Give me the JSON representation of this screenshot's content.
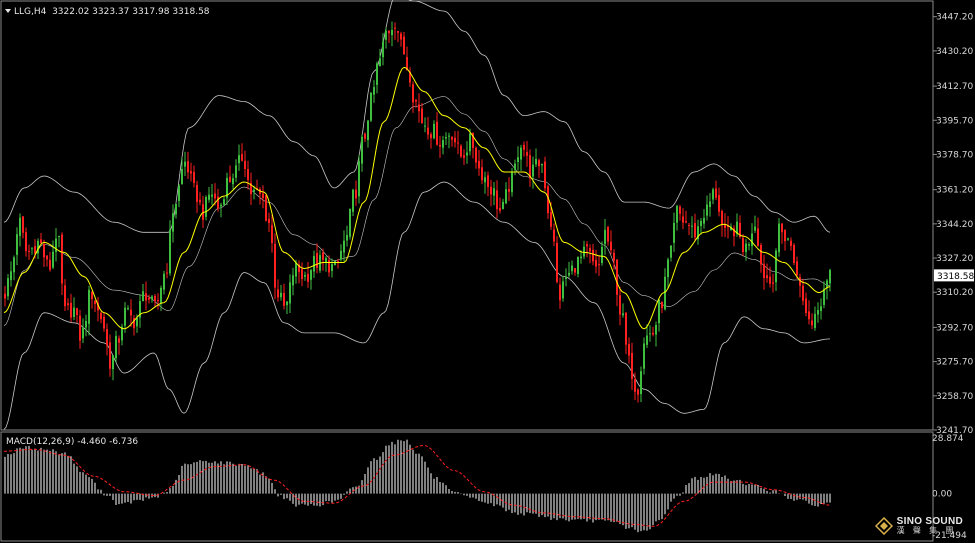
{
  "header": {
    "symbol_line": "LLG,H4  3322.02 3323.37 3317.98 3318.58",
    "macd_label": "MACD(12,26,9) -4.460 -6.736"
  },
  "logo": {
    "name": "SINO SOUND",
    "subtitle": "漢 聲 集 團"
  },
  "colors": {
    "background": "#000000",
    "bull": "#3fbf3f",
    "bear": "#ff2020",
    "ma": "#ffff00",
    "bands": "#c8c8c8",
    "macd_hist": "#ffffff",
    "macd_signal": "#ff2020",
    "price_tag_bg": "#ffffff",
    "price_tag_text": "#000000"
  },
  "chart_data": [
    {
      "type": "candlestick",
      "title": "LLG,H4",
      "last_price": "3318.58",
      "ylim": [
        3241.7,
        3455
      ],
      "y_ticks": [
        "3447.20",
        "3430.20",
        "3412.70",
        "3395.70",
        "3378.70",
        "3361.20",
        "3344.20",
        "3327.20",
        "3310.20",
        "3292.70",
        "3275.70",
        "3258.70",
        "3241.70"
      ],
      "anchors": [
        [
          0,
          3310
        ],
        [
          6,
          3320
        ],
        [
          14,
          3345
        ],
        [
          22,
          3330
        ],
        [
          34,
          3335
        ],
        [
          44,
          3322
        ],
        [
          52,
          3340
        ],
        [
          60,
          3300
        ],
        [
          68,
          3302
        ],
        [
          76,
          3288
        ],
        [
          86,
          3310
        ],
        [
          96,
          3298
        ],
        [
          106,
          3275
        ],
        [
          112,
          3285
        ],
        [
          120,
          3300
        ],
        [
          130,
          3296
        ],
        [
          140,
          3310
        ],
        [
          150,
          3302
        ],
        [
          160,
          3320
        ],
        [
          170,
          3355
        ],
        [
          180,
          3375
        ],
        [
          190,
          3360
        ],
        [
          198,
          3350
        ],
        [
          206,
          3360
        ],
        [
          214,
          3352
        ],
        [
          222,
          3365
        ],
        [
          230,
          3370
        ],
        [
          238,
          3378
        ],
        [
          246,
          3360
        ],
        [
          256,
          3358
        ],
        [
          264,
          3345
        ],
        [
          272,
          3310
        ],
        [
          280,
          3302
        ],
        [
          290,
          3322
        ],
        [
          300,
          3318
        ],
        [
          310,
          3325
        ],
        [
          320,
          3325
        ],
        [
          330,
          3322
        ],
        [
          340,
          3335
        ],
        [
          350,
          3360
        ],
        [
          358,
          3385
        ],
        [
          366,
          3405
        ],
        [
          374,
          3425
        ],
        [
          382,
          3440
        ],
        [
          390,
          3445
        ],
        [
          398,
          3430
        ],
        [
          404,
          3420
        ],
        [
          410,
          3405
        ],
        [
          418,
          3395
        ],
        [
          428,
          3390
        ],
        [
          436,
          3385
        ],
        [
          446,
          3390
        ],
        [
          456,
          3378
        ],
        [
          466,
          3385
        ],
        [
          476,
          3370
        ],
        [
          486,
          3362
        ],
        [
          496,
          3350
        ],
        [
          506,
          3365
        ],
        [
          516,
          3385
        ],
        [
          526,
          3370
        ],
        [
          536,
          3375
        ],
        [
          546,
          3345
        ],
        [
          554,
          3308
        ],
        [
          562,
          3318
        ],
        [
          572,
          3325
        ],
        [
          582,
          3330
        ],
        [
          592,
          3320
        ],
        [
          600,
          3340
        ],
        [
          608,
          3325
        ],
        [
          616,
          3300
        ],
        [
          624,
          3275
        ],
        [
          632,
          3262
        ],
        [
          640,
          3288
        ],
        [
          648,
          3290
        ],
        [
          656,
          3305
        ],
        [
          664,
          3325
        ],
        [
          672,
          3350
        ],
        [
          680,
          3345
        ],
        [
          690,
          3340
        ],
        [
          700,
          3350
        ],
        [
          710,
          3360
        ],
        [
          720,
          3338
        ],
        [
          730,
          3342
        ],
        [
          740,
          3332
        ],
        [
          750,
          3345
        ],
        [
          758,
          3320
        ],
        [
          766,
          3315
        ],
        [
          774,
          3340
        ],
        [
          782,
          3338
        ],
        [
          790,
          3325
        ],
        [
          798,
          3305
        ],
        [
          806,
          3295
        ],
        [
          814,
          3305
        ],
        [
          822,
          3318
        ],
        [
          826,
          3322
        ]
      ],
      "ma_anchors": [
        [
          0,
          3300
        ],
        [
          20,
          3320
        ],
        [
          40,
          3335
        ],
        [
          60,
          3330
        ],
        [
          80,
          3318
        ],
        [
          100,
          3300
        ],
        [
          120,
          3292
        ],
        [
          140,
          3300
        ],
        [
          160,
          3305
        ],
        [
          180,
          3330
        ],
        [
          200,
          3350
        ],
        [
          220,
          3358
        ],
        [
          240,
          3365
        ],
        [
          260,
          3360
        ],
        [
          280,
          3330
        ],
        [
          300,
          3322
        ],
        [
          320,
          3325
        ],
        [
          340,
          3325
        ],
        [
          360,
          3355
        ],
        [
          380,
          3395
        ],
        [
          400,
          3422
        ],
        [
          420,
          3410
        ],
        [
          440,
          3398
        ],
        [
          460,
          3392
        ],
        [
          480,
          3382
        ],
        [
          500,
          3370
        ],
        [
          520,
          3370
        ],
        [
          540,
          3360
        ],
        [
          560,
          3335
        ],
        [
          580,
          3330
        ],
        [
          600,
          3328
        ],
        [
          620,
          3310
        ],
        [
          640,
          3292
        ],
        [
          660,
          3310
        ],
        [
          680,
          3330
        ],
        [
          700,
          3340
        ],
        [
          720,
          3344
        ],
        [
          740,
          3338
        ],
        [
          760,
          3330
        ],
        [
          780,
          3325
        ],
        [
          800,
          3315
        ],
        [
          815,
          3310
        ],
        [
          826,
          3313
        ]
      ],
      "upper_band_anchors": [
        [
          0,
          3345
        ],
        [
          20,
          3362
        ],
        [
          40,
          3368
        ],
        [
          70,
          3360
        ],
        [
          110,
          3345
        ],
        [
          140,
          3340
        ],
        [
          165,
          3340
        ],
        [
          185,
          3392
        ],
        [
          215,
          3408
        ],
        [
          240,
          3405
        ],
        [
          265,
          3398
        ],
        [
          290,
          3385
        ],
        [
          310,
          3378
        ],
        [
          330,
          3362
        ],
        [
          350,
          3370
        ],
        [
          370,
          3420
        ],
        [
          392,
          3458
        ],
        [
          410,
          3455
        ],
        [
          440,
          3450
        ],
        [
          460,
          3440
        ],
        [
          480,
          3428
        ],
        [
          500,
          3408
        ],
        [
          520,
          3398
        ],
        [
          540,
          3400
        ],
        [
          560,
          3395
        ],
        [
          580,
          3380
        ],
        [
          600,
          3370
        ],
        [
          620,
          3355
        ],
        [
          640,
          3355
        ],
        [
          665,
          3352
        ],
        [
          690,
          3370
        ],
        [
          710,
          3374
        ],
        [
          730,
          3368
        ],
        [
          750,
          3358
        ],
        [
          770,
          3350
        ],
        [
          790,
          3345
        ],
        [
          810,
          3348
        ],
        [
          826,
          3340
        ]
      ],
      "lower_band_anchors": [
        [
          0,
          3242
        ],
        [
          20,
          3280
        ],
        [
          40,
          3300
        ],
        [
          70,
          3295
        ],
        [
          100,
          3285
        ],
        [
          120,
          3270
        ],
        [
          150,
          3280
        ],
        [
          165,
          3262
        ],
        [
          180,
          3250
        ],
        [
          200,
          3275
        ],
        [
          220,
          3300
        ],
        [
          240,
          3320
        ],
        [
          260,
          3315
        ],
        [
          280,
          3295
        ],
        [
          300,
          3290
        ],
        [
          330,
          3290
        ],
        [
          360,
          3285
        ],
        [
          380,
          3300
        ],
        [
          400,
          3340
        ],
        [
          420,
          3360
        ],
        [
          440,
          3365
        ],
        [
          470,
          3355
        ],
        [
          500,
          3345
        ],
        [
          530,
          3335
        ],
        [
          560,
          3318
        ],
        [
          590,
          3305
        ],
        [
          620,
          3275
        ],
        [
          640,
          3262
        ],
        [
          660,
          3255
        ],
        [
          680,
          3250
        ],
        [
          700,
          3252
        ],
        [
          720,
          3285
        ],
        [
          740,
          3298
        ],
        [
          760,
          3292
        ],
        [
          780,
          3290
        ],
        [
          800,
          3285
        ],
        [
          826,
          3287
        ]
      ]
    },
    {
      "type": "macd",
      "title": "MACD(12,26,9)",
      "values_label": "-4.460 -6.736",
      "ylim": [
        -21.494,
        28.874
      ],
      "y_ticks": [
        "28.874",
        "0.00",
        "-21.494"
      ],
      "hist_anchors": [
        [
          0,
          20
        ],
        [
          20,
          24
        ],
        [
          40,
          23
        ],
        [
          60,
          21
        ],
        [
          80,
          10
        ],
        [
          100,
          0
        ],
        [
          115,
          -6
        ],
        [
          130,
          -4
        ],
        [
          150,
          -2
        ],
        [
          165,
          2
        ],
        [
          180,
          15
        ],
        [
          200,
          17
        ],
        [
          220,
          16
        ],
        [
          240,
          15
        ],
        [
          260,
          10
        ],
        [
          275,
          -1
        ],
        [
          290,
          -6
        ],
        [
          310,
          -6
        ],
        [
          330,
          -4
        ],
        [
          350,
          3
        ],
        [
          370,
          18
        ],
        [
          385,
          26
        ],
        [
          400,
          28
        ],
        [
          415,
          20
        ],
        [
          430,
          8
        ],
        [
          450,
          0
        ],
        [
          470,
          -3
        ],
        [
          490,
          -6
        ],
        [
          510,
          -10
        ],
        [
          530,
          -11
        ],
        [
          550,
          -13
        ],
        [
          570,
          -14
        ],
        [
          590,
          -14
        ],
        [
          610,
          -15
        ],
        [
          625,
          -18
        ],
        [
          640,
          -20
        ],
        [
          655,
          -14
        ],
        [
          670,
          -2
        ],
        [
          690,
          8
        ],
        [
          710,
          10
        ],
        [
          730,
          7
        ],
        [
          750,
          4
        ],
        [
          770,
          1
        ],
        [
          790,
          -3
        ],
        [
          810,
          -6
        ],
        [
          826,
          -5
        ]
      ],
      "signal_anchors": [
        [
          0,
          22
        ],
        [
          30,
          23
        ],
        [
          60,
          20
        ],
        [
          90,
          9
        ],
        [
          120,
          1
        ],
        [
          150,
          -1
        ],
        [
          180,
          7
        ],
        [
          210,
          14
        ],
        [
          240,
          15
        ],
        [
          270,
          7
        ],
        [
          300,
          -4
        ],
        [
          330,
          -5
        ],
        [
          360,
          4
        ],
        [
          390,
          20
        ],
        [
          420,
          25
        ],
        [
          450,
          12
        ],
        [
          480,
          1
        ],
        [
          510,
          -6
        ],
        [
          540,
          -10
        ],
        [
          570,
          -12
        ],
        [
          600,
          -13
        ],
        [
          630,
          -16
        ],
        [
          650,
          -17
        ],
        [
          680,
          -4
        ],
        [
          710,
          6
        ],
        [
          740,
          6
        ],
        [
          770,
          2
        ],
        [
          800,
          -2
        ],
        [
          826,
          -6
        ]
      ]
    }
  ]
}
